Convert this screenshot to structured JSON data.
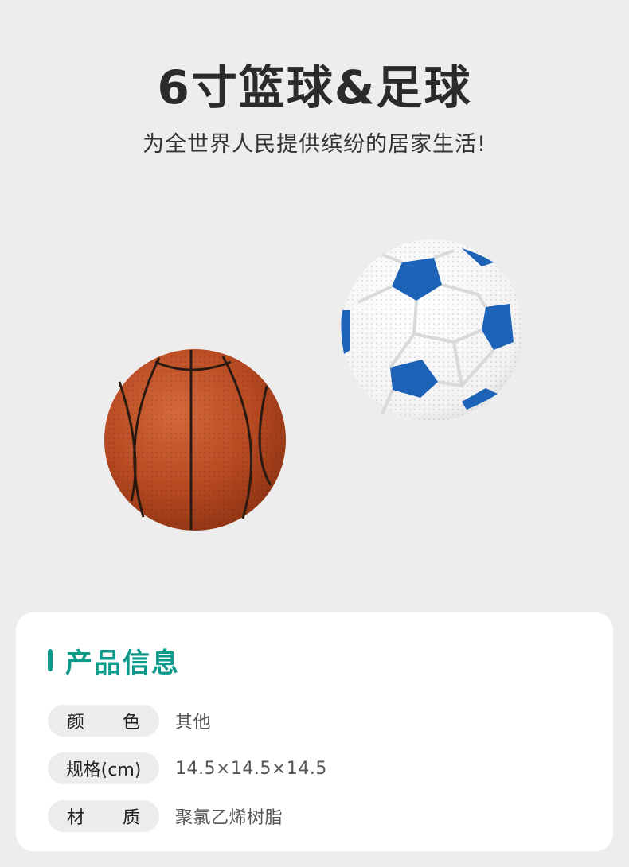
{
  "header": {
    "title": "6寸篮球&足球",
    "subtitle": "为全世界人民提供缤纷的居家生活!"
  },
  "images": [
    {
      "name": "basketball",
      "color": "#b84a22"
    },
    {
      "name": "soccer-ball",
      "color": "#1c63b8"
    }
  ],
  "info": {
    "section_title": "产品信息",
    "accent_color": "#0e9a8a",
    "rows": [
      {
        "label_a": "颜",
        "label_b": "色",
        "value": "其他"
      },
      {
        "label": "规格(cm)",
        "value": "14.5×14.5×14.5"
      },
      {
        "label_a": "材",
        "label_b": "质",
        "value": "聚氯乙烯树脂"
      }
    ]
  }
}
